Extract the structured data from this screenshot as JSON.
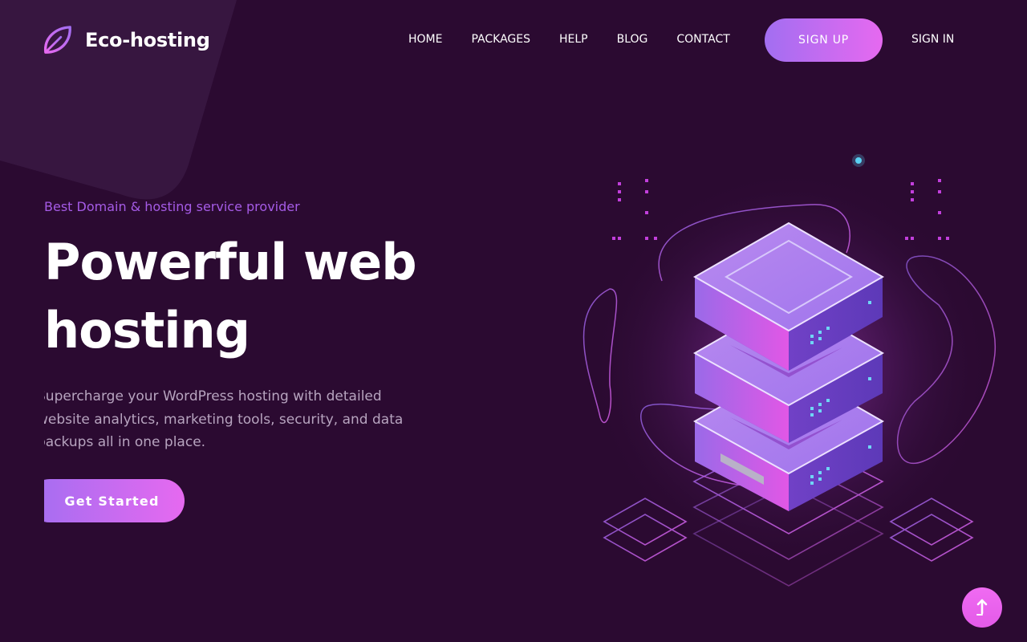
{
  "brand": {
    "name": "Eco-hosting",
    "icon": "leaf-icon",
    "accent": "#a55be6"
  },
  "nav": {
    "items": [
      {
        "label": "HOME"
      },
      {
        "label": "PACKAGES"
      },
      {
        "label": "HELP"
      },
      {
        "label": "BLOG"
      },
      {
        "label": "CONTACT"
      }
    ],
    "signup_label": "SIGN UP",
    "signin_label": "SIGN IN"
  },
  "hero": {
    "subtitle": "Best Domain & hosting service provider",
    "title": "Powerful web hosting",
    "description": "Supercharge your WordPress hosting with detailed website analytics, marketing tools, security, and data backups all in one place.",
    "cta_label": "Get Started"
  },
  "illustration": {
    "icon": "server-stack-illustration"
  },
  "scroll_top": {
    "icon": "arrow-up-icon"
  },
  "colors": {
    "background": "#2b0a31",
    "gradient_start": "#a26ef1",
    "gradient_end": "#e669f0",
    "text_muted": "#b7a4bf"
  }
}
